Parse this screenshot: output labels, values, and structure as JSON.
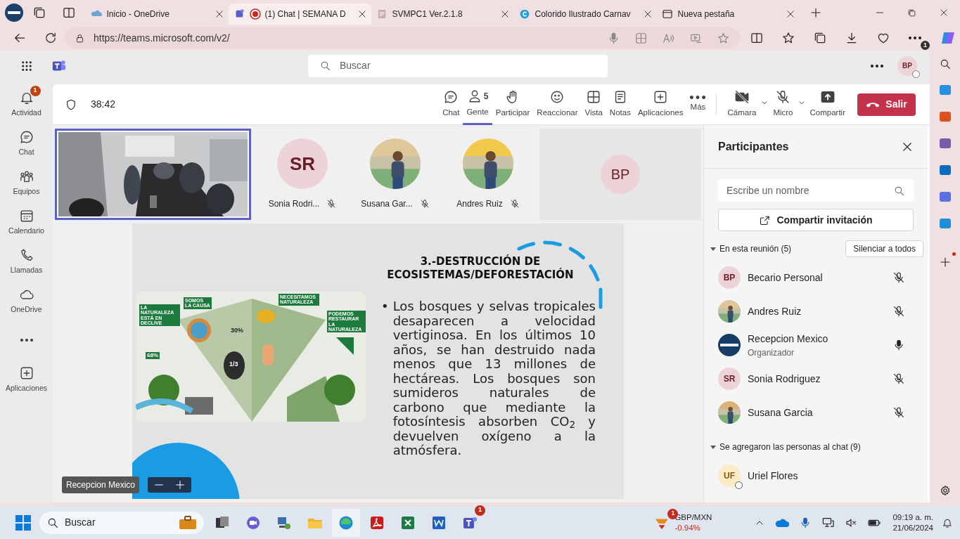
{
  "browser": {
    "tabs": [
      {
        "title": "Inicio - OneDrive",
        "selected": false,
        "recording": false
      },
      {
        "title": "(1) Chat | SEMANA D",
        "selected": true,
        "recording": true
      },
      {
        "title": "SVMPC1 Ver.2.1.8",
        "selected": false,
        "recording": false
      },
      {
        "title": "Colorido Ilustrado Carnav",
        "selected": false,
        "recording": false
      },
      {
        "title": "Nueva pestaña",
        "selected": false,
        "recording": false
      }
    ],
    "url": "https://teams.microsoft.com/v2/",
    "menu_badge": "1"
  },
  "teams": {
    "search": {
      "placeholder": "Buscar"
    },
    "profile_initials": "BP",
    "rail": [
      {
        "kind": "app",
        "label": "Actividad",
        "badge": "1"
      },
      {
        "kind": "app",
        "label": "Chat"
      },
      {
        "kind": "app",
        "label": "Equipos"
      },
      {
        "kind": "app",
        "label": "Calendario"
      },
      {
        "kind": "app",
        "label": "Llamadas"
      },
      {
        "kind": "app",
        "label": "OneDrive"
      },
      {
        "kind": "more"
      },
      {
        "kind": "app",
        "label": "Aplicaciones"
      }
    ]
  },
  "meeting": {
    "timer": "38:42",
    "toolbar": [
      {
        "label": "Chat",
        "selected": false
      },
      {
        "label": "Gente",
        "count": "5",
        "selected": true
      },
      {
        "label": "Participar",
        "selected": false
      },
      {
        "label": "Reaccionar",
        "selected": false
      },
      {
        "label": "Vista",
        "selected": false
      },
      {
        "label": "Notas",
        "selected": false
      },
      {
        "label": "Aplicaciones",
        "selected": false
      },
      {
        "label": "Más",
        "selected": false
      }
    ],
    "devices": [
      {
        "label": "Cámara",
        "off": true
      },
      {
        "label": "Micro",
        "off": true
      }
    ],
    "share": "Compartir",
    "leave": "Salir",
    "gallery": [
      {
        "name": "Sonia Rodri...",
        "kind": "initials",
        "initials": "SR",
        "muted": true
      },
      {
        "name": "Susana Gar...",
        "muted": true
      },
      {
        "name": "Andres Ruiz",
        "muted": true
      }
    ],
    "self_initials": "BP",
    "presenter": "Recepcion Mexico"
  },
  "slide": {
    "title_lines": [
      "3.-DESTRUCCIÓN DE",
      "ECOSISTEMAS/DEFORESTACIÓN"
    ],
    "infographic_labels": [
      "LA NATURALEZA ESTÁ EN DECLIVE",
      "68%",
      "SOMOS LA CAUSA",
      "1/3",
      "30%",
      "NECESITAMOS NATURALEZA",
      "PODEMOS RESTAURAR LA NATURALEZA"
    ],
    "bullet": "•",
    "text": "Los bosques y selvas tropicales desaparecen a velocidad vertiginosa. En los últimos 10 años, se han destruido nada menos que 13 millones de hectáreas. Los bosques son sumideros naturales de carbono que mediante la fotosíntesis absorben CO$_{2}$ y devuelven oxígeno a la atmósfera."
  },
  "participants": {
    "title": "Participantes",
    "search_placeholder": "Escribe un nombre",
    "invite": "Compartir invitación",
    "groups": [
      {
        "label": "En esta reunión (5)",
        "expanded": true,
        "action": "Silenciar a todos",
        "people": [
          {
            "name": "Becario Personal",
            "kind": "initials",
            "initials": "BP",
            "color": "#ecd3d6",
            "muted": true
          },
          {
            "name": "Andres Ruiz",
            "muted": true
          },
          {
            "name": "Recepcion Mexico",
            "role": "Organizador",
            "kind": "logo",
            "muted": false
          },
          {
            "name": "Sonia Rodriguez",
            "kind": "initials",
            "initials": "SR",
            "color": "#ecd3d6",
            "muted": true
          },
          {
            "name": "Susana Garcia",
            "muted": true
          }
        ]
      },
      {
        "label": "Se agregaron las personas al chat (9)",
        "expanded": true,
        "people": [
          {
            "name": "Uriel Flores",
            "kind": "initials",
            "initials": "UF",
            "color": "#fbebc6",
            "offline": true
          }
        ]
      }
    ]
  },
  "taskbar": {
    "search": "Buscar",
    "teams_badge": "1",
    "widget": {
      "badge": "1",
      "symbol": "GBP/MXN",
      "change": "-0.94%"
    },
    "time": "09:19 a. m.",
    "date": "21/06/2024"
  }
}
